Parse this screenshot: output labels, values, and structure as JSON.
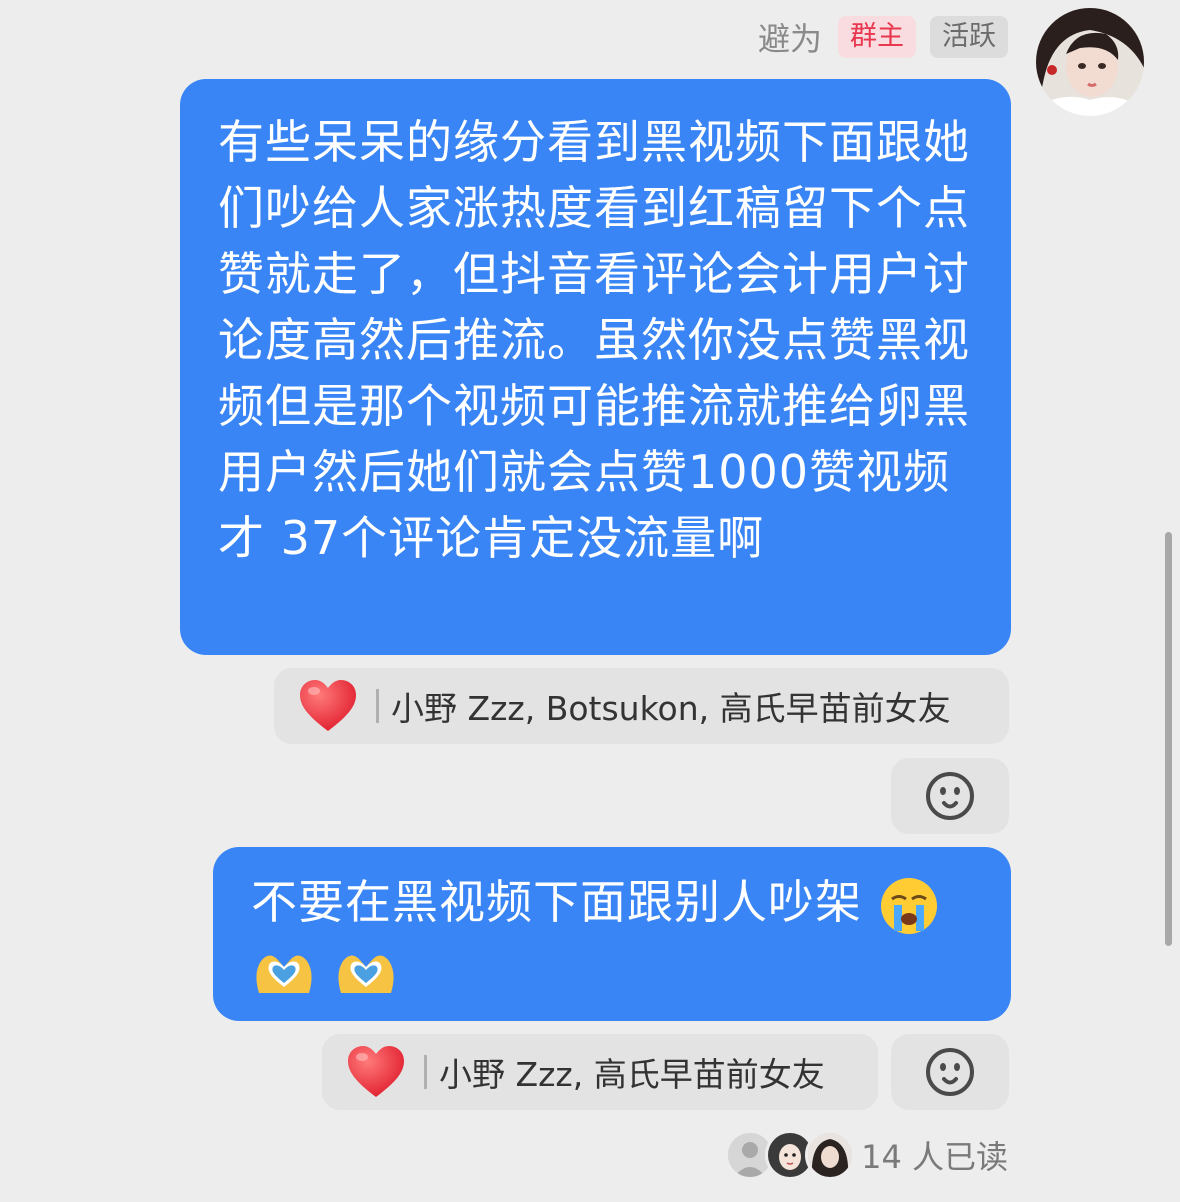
{
  "sender": {
    "name": "避为",
    "badges": [
      "群主",
      "活跃"
    ]
  },
  "messages": [
    {
      "text": "有些呆呆的缘分看到黑视频下面跟她们吵给人家涨热度看到红稿留下个点赞就走了，但抖音看评论会计用户讨论度高然后推流。虽然你没点赞黑视频但是那个视频可能推流就推给卵黑用户然后她们就会点赞1000赞视频才 37个评论肯定没流量啊",
      "reaction": {
        "emoji": "heart",
        "names": "小野 Zzz, Botsukon, 高氏早苗前女友"
      }
    },
    {
      "text": "不要在黑视频下面跟别人吵架",
      "emojis": [
        "loudly-crying-face",
        "heart-hands",
        "heart-hands"
      ],
      "reaction": {
        "emoji": "heart",
        "names": "小野 Zzz, 高氏早苗前女友"
      }
    }
  ],
  "read_receipt": {
    "text": "14 人已读"
  },
  "icons": {
    "add_reaction": "smiley-face-icon"
  },
  "colors": {
    "bubble": "#3985f6",
    "background": "#ededed",
    "owner_badge_text": "#e8374f",
    "owner_badge_bg": "#f8dcdf"
  }
}
